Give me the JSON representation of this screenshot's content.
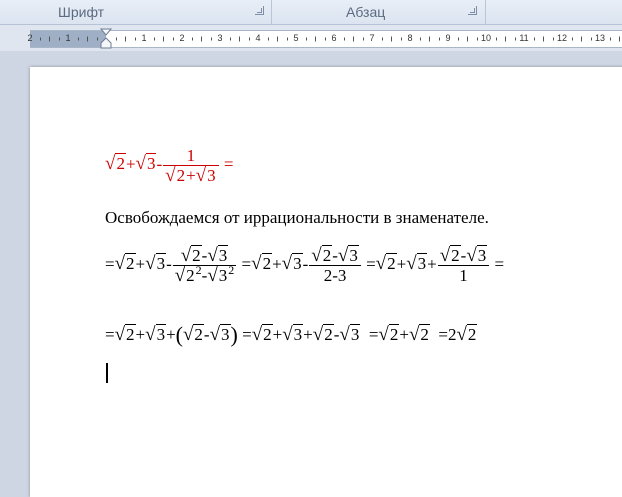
{
  "ribbon": {
    "groups": [
      {
        "label": "Шрифт",
        "launcher": "dialog-launcher-icon"
      },
      {
        "label": "Абзац",
        "launcher": "dialog-launcher-icon"
      }
    ]
  },
  "ruler": {
    "numbers": [
      "2",
      "1",
      "1",
      "2",
      "3",
      "4",
      "5",
      "6",
      "7",
      "8",
      "9",
      "10",
      "11",
      "12",
      "13"
    ]
  },
  "document": {
    "eq1": {
      "r1": "2",
      "plus": "+",
      "r2": "3",
      "minus": "-",
      "frac_num": "1",
      "frac_den_r1": "2",
      "frac_den_plus": "+",
      "frac_den_r2": "3",
      "equals": "="
    },
    "text": "Освобождаемся от иррациональности в знаменателе.",
    "eq2": {
      "eq": "=",
      "r1": "2",
      "plus": "+",
      "r2": "3",
      "minus": "-",
      "f1_num_r1": "2",
      "f1_num_minus": "-",
      "f1_num_r2": "3",
      "f1_den_r1": "2",
      "f1_den_exp1": "2",
      "f1_den_minus": "-",
      "f1_den_r2": "3",
      "f1_den_exp2": "2",
      "eq_b": "=",
      "r1b": "2",
      "plus_b": "+",
      "r2b": "3",
      "minus_b": "-",
      "f2_num_r1": "2",
      "f2_num_minus": "-",
      "f2_num_r2": "3",
      "f2_den": "2-3",
      "eq_c": "=",
      "r1c": "2",
      "plus_c": "+",
      "r2c": "3",
      "plus_c2": "+",
      "f3_num_r1": "2",
      "f3_num_minus": "-",
      "f3_num_r2": "3",
      "f3_den": "1",
      "eq_end": "="
    },
    "eq3": {
      "eq": "=",
      "r1": "2",
      "plus": "+",
      "r2": "3",
      "plus2": "+",
      "lparen": "(",
      "p_r1": "2",
      "p_minus": "-",
      "p_r2": "3",
      "rparen": ")",
      "eq_b": "=",
      "r1b": "2",
      "plus_b": "+",
      "r2b": "3",
      "plus_b2": "+",
      "r3b": "2",
      "minus_b": "-",
      "r4b": "3",
      "eq_c": "=",
      "r1c": "2",
      "plus_c": "+",
      "r2c": "2",
      "eq_d": "=",
      "coef": "2",
      "r1d": "2"
    },
    "colors": {
      "equation1": "#cc0000",
      "text": "#000000"
    }
  }
}
